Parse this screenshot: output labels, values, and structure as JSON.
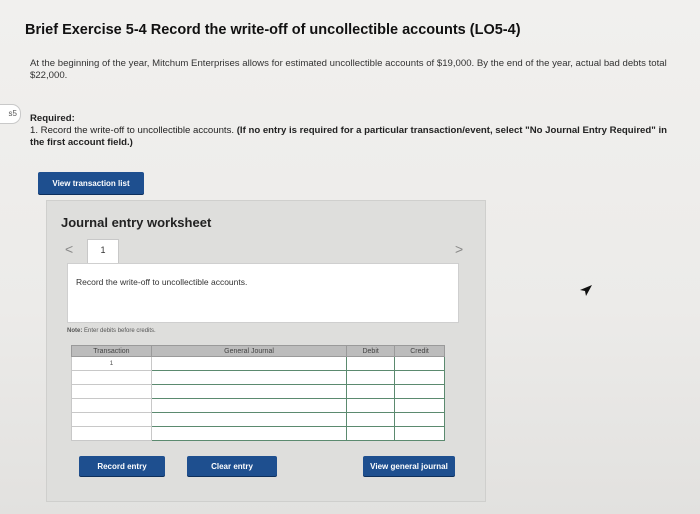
{
  "side_badge": "s5",
  "title": "Brief Exercise 5-4 Record the write-off of uncollectible accounts (LO5-4)",
  "paragraph": "At the beginning of the year, Mitchum Enterprises allows for estimated uncollectible accounts of $19,000. By the end of the year, actual bad debts total $22,000.",
  "required": {
    "label": "Required:",
    "item_prefix": "1. Record the write-off to uncollectible accounts. ",
    "item_bold": "(If no entry is required for a particular transaction/event, select \"No Journal Entry Required\" in the first account field.)"
  },
  "buttons": {
    "view_transaction_list": "View transaction list",
    "record_entry": "Record entry",
    "clear_entry": "Clear entry",
    "view_general_journal": "View general journal"
  },
  "worksheet": {
    "title": "Journal entry worksheet",
    "prev": "<",
    "next": ">",
    "active_tab": "1",
    "instruction": "Record the write-off to uncollectible accounts.",
    "note_label": "Note:",
    "note_text": " Enter debits before credits."
  },
  "journal": {
    "headers": [
      "Transaction",
      "General Journal",
      "Debit",
      "Credit"
    ],
    "rows": [
      [
        "1",
        "",
        "",
        ""
      ],
      [
        "",
        "",
        "",
        ""
      ],
      [
        "",
        "",
        "",
        ""
      ],
      [
        "",
        "",
        "",
        ""
      ],
      [
        "",
        "",
        "",
        ""
      ],
      [
        "",
        "",
        "",
        ""
      ]
    ]
  },
  "colors": {
    "button_blue": "#1e4f8f",
    "grid_green": "#5b8a6f"
  }
}
